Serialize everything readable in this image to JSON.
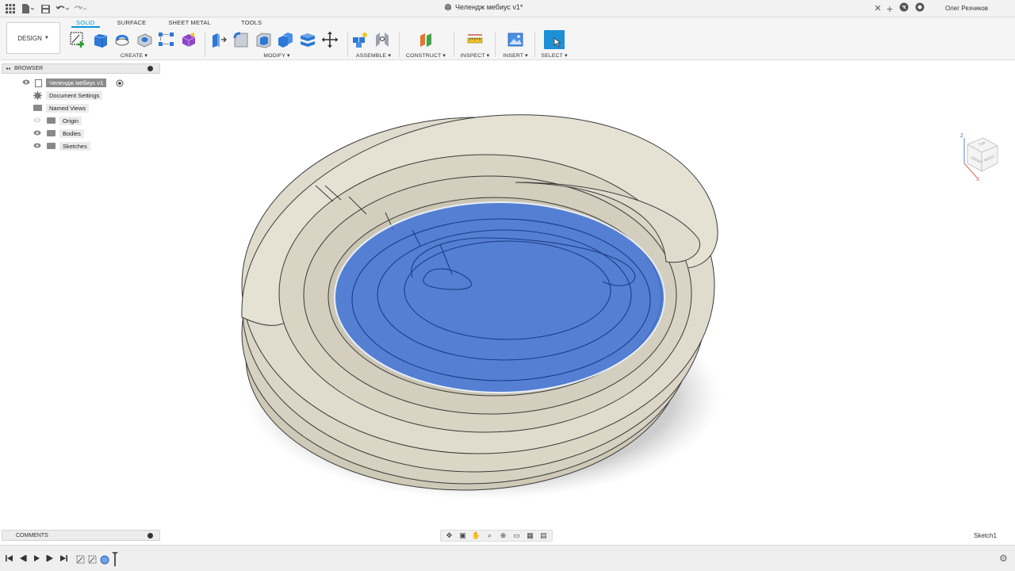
{
  "window": {
    "document_title": "Челендж мебиус v1*",
    "user_name": "Олег Резчиков"
  },
  "toolbar": {
    "workspace_label": "DESIGN",
    "tabs": [
      "SOLID",
      "SURFACE",
      "SHEET METAL",
      "TOOLS"
    ],
    "active_tab": "SOLID",
    "groups": {
      "create": "CREATE",
      "modify": "MODIFY",
      "assemble": "ASSEMBLE",
      "construct": "CONSTRUCT",
      "inspect": "INSPECT",
      "insert": "INSERT",
      "select": "SELECT"
    }
  },
  "browser": {
    "title": "BROWSER",
    "root": "Челендж мебиус v1",
    "items": [
      "Document Settings",
      "Named Views",
      "Origin",
      "Bodies",
      "Sketches"
    ]
  },
  "viewcube": {
    "faces": [
      "TOP",
      "FRONT",
      "RIGHT"
    ],
    "axes": [
      "Z",
      "X"
    ]
  },
  "comments": {
    "title": "COMMENTS"
  },
  "status": {
    "active_item": "Sketch1"
  },
  "colors": {
    "accent": "#0696d7",
    "body": "#d9d4c5",
    "selection": "#3b6fd8"
  }
}
